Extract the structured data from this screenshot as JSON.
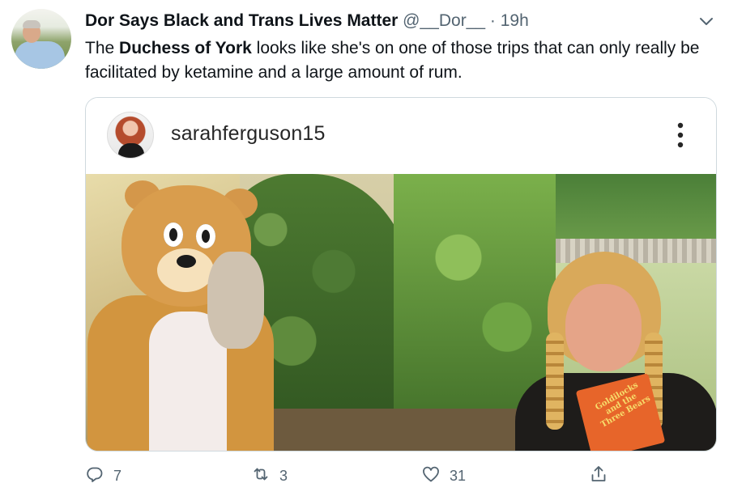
{
  "tweet": {
    "author_name": "Dor Says Black and Trans Lives Matter",
    "handle": "@__Dor__",
    "separator": "·",
    "time": "19h",
    "text_before": "The ",
    "text_bold": "Duchess of York",
    "text_after": " looks like she's on one of those trips that can only really be facilitated by ketamine and a large amount of rum."
  },
  "embed": {
    "username": "sarahferguson15",
    "book_title": "Goldilocks and the Three Bears"
  },
  "actions": {
    "reply_count": "7",
    "retweet_count": "3",
    "like_count": "31"
  },
  "icons": {
    "caret": "chevron-down-icon",
    "more": "more-vertical-icon",
    "reply": "reply-icon",
    "retweet": "retweet-icon",
    "like": "heart-icon",
    "share": "share-icon"
  },
  "colors": {
    "text_primary": "#0f1419",
    "text_secondary": "#536471",
    "border": "#cfd9de"
  }
}
